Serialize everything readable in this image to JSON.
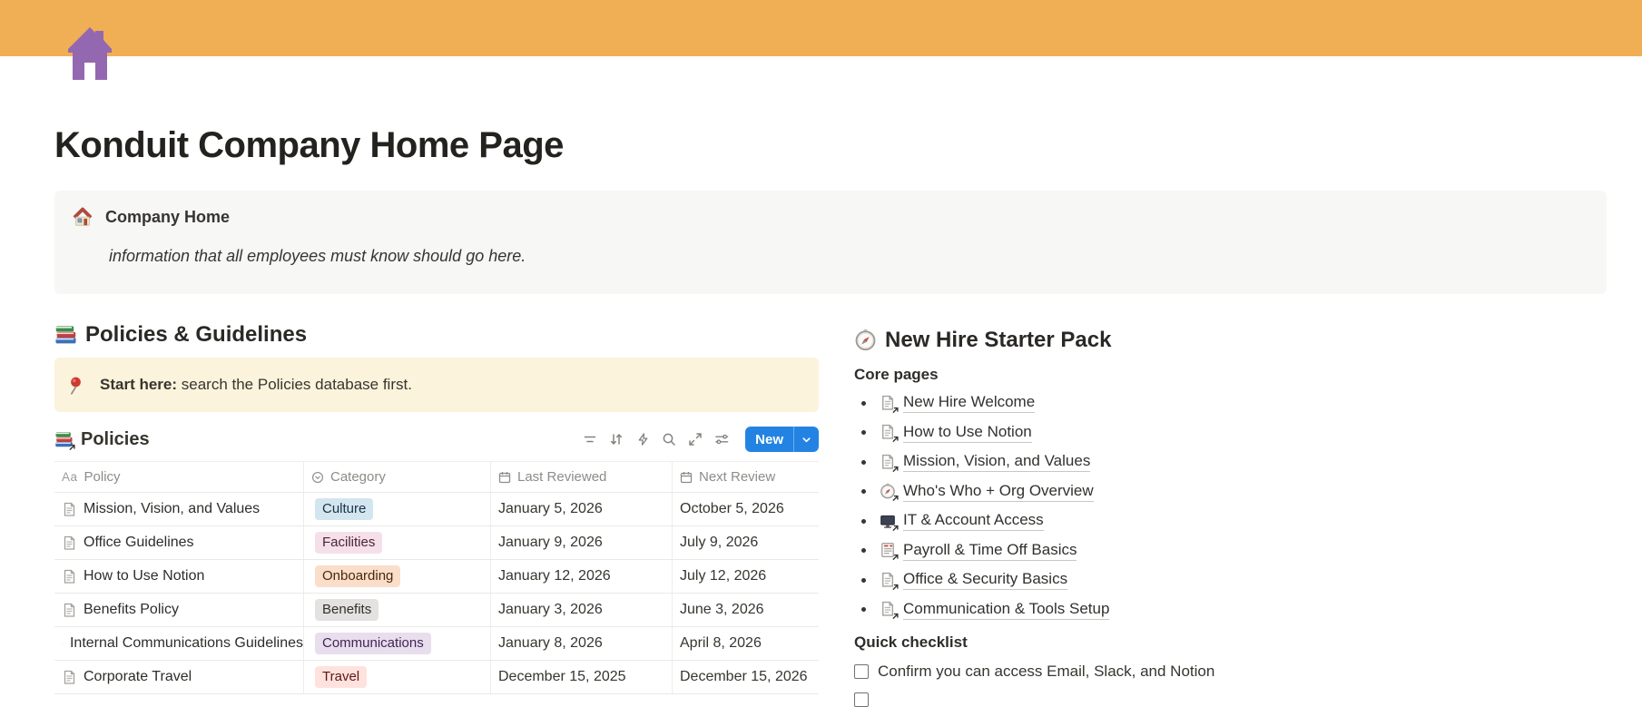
{
  "page": {
    "title": "Konduit Company Home Page"
  },
  "banner": {
    "color": "#F0AF54",
    "icon": "purple-house",
    "icon_color": "#9468B0"
  },
  "company_callout": {
    "icon": "house-emoji",
    "title": "Company Home",
    "body": "information that all employees must know should go here."
  },
  "left": {
    "section_title": "Policies & Guidelines",
    "section_icon": "books-emoji",
    "pin_callout": {
      "icon": "pushpin-emoji",
      "bold": "Start here:",
      "rest": " search the Policies database first."
    },
    "database": {
      "icon": "books-emoji-linked",
      "title": "Policies",
      "toolbar_icons": [
        "filter",
        "sort",
        "automations",
        "search",
        "expand",
        "view-settings"
      ],
      "new_button_label": "New",
      "columns": [
        {
          "label": "Policy",
          "icon": "title-Aa"
        },
        {
          "label": "Category",
          "icon": "select-circle-chevron"
        },
        {
          "label": "Last Reviewed",
          "icon": "calendar"
        },
        {
          "label": "Next Review",
          "icon": "calendar"
        }
      ],
      "rows": [
        {
          "policy": "Mission, Vision, and Values",
          "category": "Culture",
          "category_color": "blue",
          "last_reviewed": "January 5, 2026",
          "next_review": "October 5, 2026"
        },
        {
          "policy": "Office Guidelines",
          "category": "Facilities",
          "category_color": "pink",
          "last_reviewed": "January 9, 2026",
          "next_review": "July 9, 2026"
        },
        {
          "policy": "How to Use Notion",
          "category": "Onboarding",
          "category_color": "orange",
          "last_reviewed": "January 12, 2026",
          "next_review": "July 12, 2026"
        },
        {
          "policy": "Benefits Policy",
          "category": "Benefits",
          "category_color": "gray",
          "last_reviewed": "January 3, 2026",
          "next_review": "June 3, 2026"
        },
        {
          "policy": "Internal Communications Guidelines",
          "category": "Communications",
          "category_color": "purple",
          "last_reviewed": "January 8, 2026",
          "next_review": "April 8, 2026"
        },
        {
          "policy": "Corporate Travel",
          "category": "Travel",
          "category_color": "red",
          "last_reviewed": "December 15, 2025",
          "next_review": "December 15, 2026"
        }
      ],
      "tag_colors": {
        "blue": {
          "bg": "#D3E5EF",
          "text": "#183347"
        },
        "pink": {
          "bg": "#F5E0E9",
          "text": "#4C2337"
        },
        "orange": {
          "bg": "#FADEC9",
          "text": "#49290E"
        },
        "gray": {
          "bg": "#E3E2E0",
          "text": "#32302C"
        },
        "purple": {
          "bg": "#E8DEEE",
          "text": "#412454"
        },
        "red": {
          "bg": "#FFE2DD",
          "text": "#5D1715"
        }
      }
    }
  },
  "right": {
    "section_title": "New Hire Starter Pack",
    "section_icon": "compass-emoji",
    "core_pages_label": "Core pages",
    "links": [
      {
        "label": "New Hire Welcome",
        "icon": "page-link"
      },
      {
        "label": "How to Use Notion",
        "icon": "page-link"
      },
      {
        "label": "Mission, Vision, and Values",
        "icon": "page-link"
      },
      {
        "label": "Who's Who + Org Overview",
        "icon": "compass-link"
      },
      {
        "label": "IT & Account Access",
        "icon": "screen-link"
      },
      {
        "label": "Payroll & Time Off Basics",
        "icon": "payroll-sheet-link"
      },
      {
        "label": "Office & Security Basics",
        "icon": "page-link"
      },
      {
        "label": "Communication & Tools Setup",
        "icon": "page-link"
      }
    ],
    "checklist_label": "Quick checklist",
    "todos": [
      {
        "label": "Confirm you can access Email, Slack, and Notion",
        "checked": false
      }
    ]
  },
  "accent_colors": {
    "new_button": "#2383E2",
    "callout_gray": "#F7F7F5",
    "callout_yellow": "#FBF3DB",
    "table_border": "#E9E9E7"
  }
}
